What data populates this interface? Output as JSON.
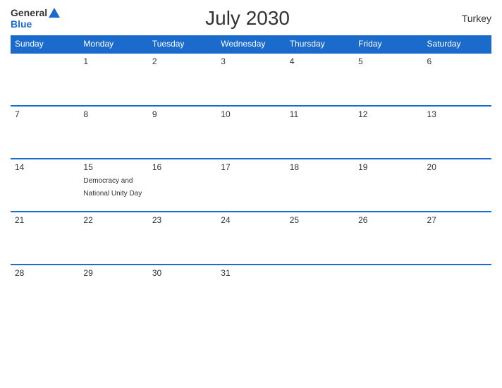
{
  "header": {
    "logo_general": "General",
    "logo_blue": "Blue",
    "title": "July 2030",
    "country": "Turkey"
  },
  "weekdays": [
    "Sunday",
    "Monday",
    "Tuesday",
    "Wednesday",
    "Thursday",
    "Friday",
    "Saturday"
  ],
  "weeks": [
    [
      {
        "day": "",
        "empty": true
      },
      {
        "day": "1",
        "empty": false,
        "event": ""
      },
      {
        "day": "2",
        "empty": false,
        "event": ""
      },
      {
        "day": "3",
        "empty": false,
        "event": ""
      },
      {
        "day": "4",
        "empty": false,
        "event": ""
      },
      {
        "day": "5",
        "empty": false,
        "event": ""
      },
      {
        "day": "6",
        "empty": false,
        "event": ""
      }
    ],
    [
      {
        "day": "7",
        "empty": false,
        "event": ""
      },
      {
        "day": "8",
        "empty": false,
        "event": ""
      },
      {
        "day": "9",
        "empty": false,
        "event": ""
      },
      {
        "day": "10",
        "empty": false,
        "event": ""
      },
      {
        "day": "11",
        "empty": false,
        "event": ""
      },
      {
        "day": "12",
        "empty": false,
        "event": ""
      },
      {
        "day": "13",
        "empty": false,
        "event": ""
      }
    ],
    [
      {
        "day": "14",
        "empty": false,
        "event": ""
      },
      {
        "day": "15",
        "empty": false,
        "event": "Democracy and National Unity Day"
      },
      {
        "day": "16",
        "empty": false,
        "event": ""
      },
      {
        "day": "17",
        "empty": false,
        "event": ""
      },
      {
        "day": "18",
        "empty": false,
        "event": ""
      },
      {
        "day": "19",
        "empty": false,
        "event": ""
      },
      {
        "day": "20",
        "empty": false,
        "event": ""
      }
    ],
    [
      {
        "day": "21",
        "empty": false,
        "event": ""
      },
      {
        "day": "22",
        "empty": false,
        "event": ""
      },
      {
        "day": "23",
        "empty": false,
        "event": ""
      },
      {
        "day": "24",
        "empty": false,
        "event": ""
      },
      {
        "day": "25",
        "empty": false,
        "event": ""
      },
      {
        "day": "26",
        "empty": false,
        "event": ""
      },
      {
        "day": "27",
        "empty": false,
        "event": ""
      }
    ],
    [
      {
        "day": "28",
        "empty": false,
        "event": ""
      },
      {
        "day": "29",
        "empty": false,
        "event": ""
      },
      {
        "day": "30",
        "empty": false,
        "event": ""
      },
      {
        "day": "31",
        "empty": false,
        "event": ""
      },
      {
        "day": "",
        "empty": true
      },
      {
        "day": "",
        "empty": true
      },
      {
        "day": "",
        "empty": true
      }
    ]
  ]
}
